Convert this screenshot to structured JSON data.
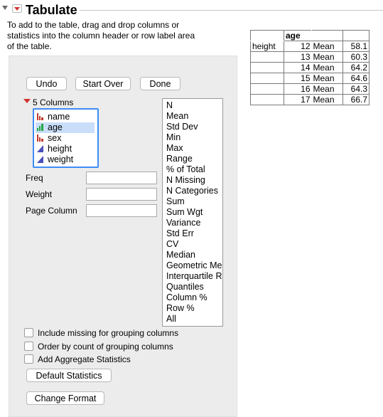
{
  "header": {
    "title": "Tabulate"
  },
  "instructions": "To add to the table, drag and drop columns or\nstatistics into the column header or row label area\nof the table.",
  "buttons": {
    "undo": "Undo",
    "start_over": "Start Over",
    "done": "Done",
    "default_stats": "Default Statistics",
    "change_format": "Change Format"
  },
  "columns": {
    "header": "5 Columns",
    "items": [
      {
        "label": "name",
        "type": "nominal"
      },
      {
        "label": "age",
        "type": "ordinal",
        "selected": true
      },
      {
        "label": "sex",
        "type": "nominal"
      },
      {
        "label": "height",
        "type": "continuous"
      },
      {
        "label": "weight",
        "type": "continuous"
      }
    ]
  },
  "fields": {
    "freq": "Freq",
    "weight": "Weight",
    "page_column": "Page Column"
  },
  "statistics": [
    "N",
    "Mean",
    "Std Dev",
    "Min",
    "Max",
    "Range",
    "% of Total",
    "N Missing",
    "N Categories",
    "Sum",
    "Sum Wgt",
    "Variance",
    "Std Err",
    "CV",
    "Median",
    "Geometric Mean",
    "Interquartile Range",
    "Quantiles",
    "Column %",
    "Row %",
    "All"
  ],
  "options": {
    "include_missing": "Include missing for grouping columns",
    "order_by_count": "Order by count of grouping columns",
    "add_aggregate": "Add Aggregate Statistics"
  },
  "table": {
    "col_header": "age",
    "row_label": "height",
    "stat": "Mean",
    "rows": [
      {
        "age": "12",
        "value": "58.1"
      },
      {
        "age": "13",
        "value": "60.3"
      },
      {
        "age": "14",
        "value": "64.2"
      },
      {
        "age": "15",
        "value": "64.6"
      },
      {
        "age": "16",
        "value": "64.3"
      },
      {
        "age": "17",
        "value": "66.7"
      }
    ]
  },
  "colors": {
    "red_arrow": "#d1322f",
    "selection": "#c9def8",
    "focus": "#3f8cf5",
    "panel": "#ececec"
  }
}
